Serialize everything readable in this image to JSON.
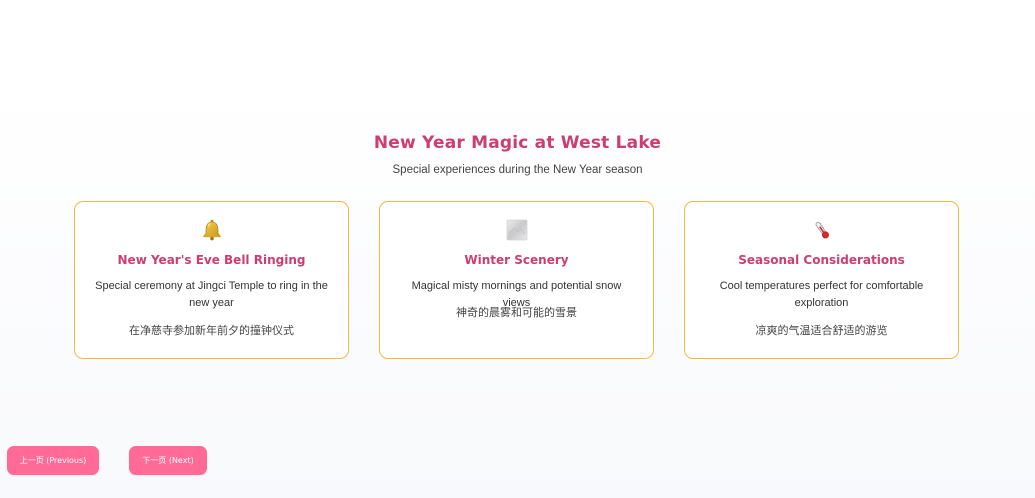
{
  "header": {
    "title": "New Year Magic at West Lake",
    "subtitle": "Special experiences during the New Year season"
  },
  "cards": [
    {
      "icon": "bell-icon",
      "title": "New Year's Eve Bell Ringing",
      "description": "Special ceremony at Jingci Temple to ring in the new year",
      "description_zh": "在净慈寺参加新年前夕的撞钟仪式"
    },
    {
      "icon": "snow-scenery-icon",
      "title": "Winter Scenery",
      "description": "Magical misty mornings and potential snow views",
      "description_zh": "神奇的晨雾和可能的雪景"
    },
    {
      "icon": "thermometer-icon",
      "title": "Seasonal Considerations",
      "description": "Cool temperatures perfect for comfortable exploration",
      "description_zh": "凉爽的气温适合舒适的游览"
    }
  ],
  "navigation": {
    "prev_label": "上一页 (Previous)",
    "next_label": "下一页 (Next)"
  },
  "colors": {
    "accent": "#cc3d72",
    "card_border": "#f5b942",
    "button": "#ff6a97"
  }
}
